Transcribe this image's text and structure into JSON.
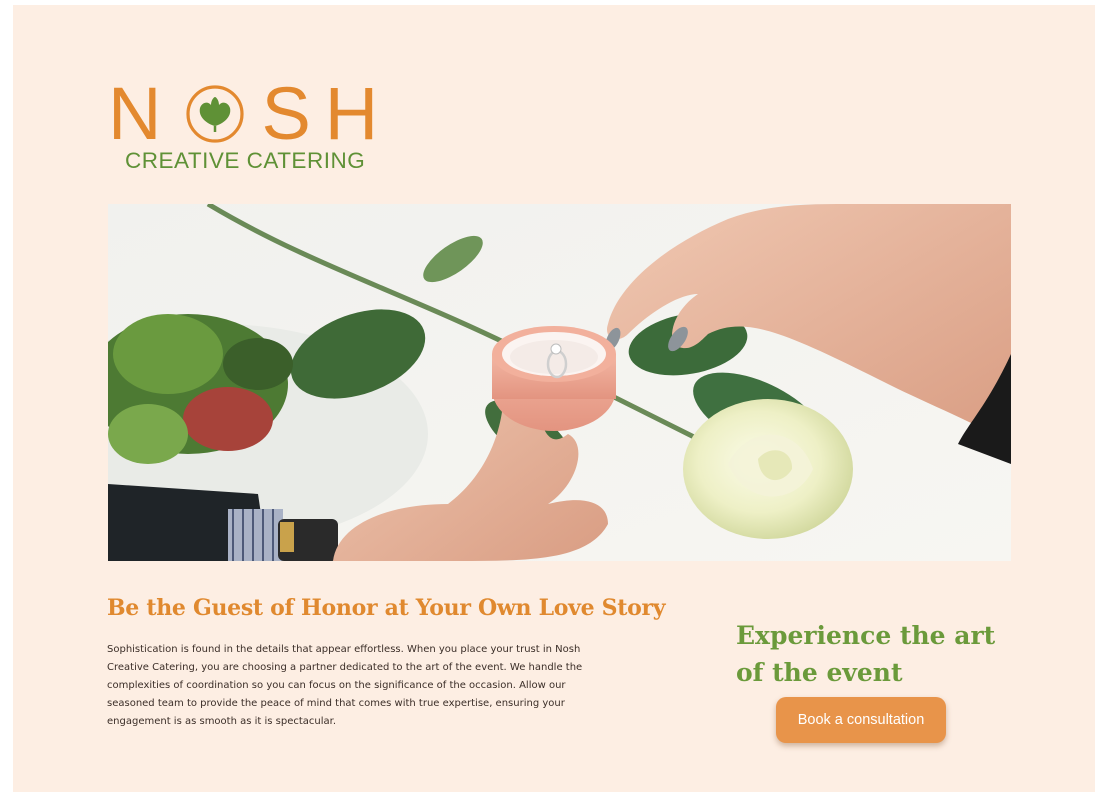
{
  "brand": {
    "name": "NOSH",
    "tagline": "CREATIVE CATERING",
    "primary_color": "#e3892f",
    "secondary_color": "#5f9136",
    "logo_icon": "ginkgo-leaf-icon"
  },
  "hero": {
    "image": "engagement-ring-box-hands-photo"
  },
  "story": {
    "title": "Be the Guest of Honor at Your Own Love Story",
    "body": "Sophistication is found in the details that appear effortless. When you place your trust in Nosh Creative Catering, you are choosing a partner dedicated to the art of the event. We handle the complexities of coordination so you can focus on the significance of the occasion. Allow our seasoned team to provide the peace of mind that comes with true expertise, ensuring your engagement is as smooth as it is spectacular."
  },
  "cta": {
    "title": "Experience the art of the event",
    "button_label": "Book a consultation",
    "button_color": "#e8944a"
  },
  "colors": {
    "page_background": "#fdeee3",
    "title_orange": "#e0892f",
    "title_green": "#6b9a3b"
  }
}
